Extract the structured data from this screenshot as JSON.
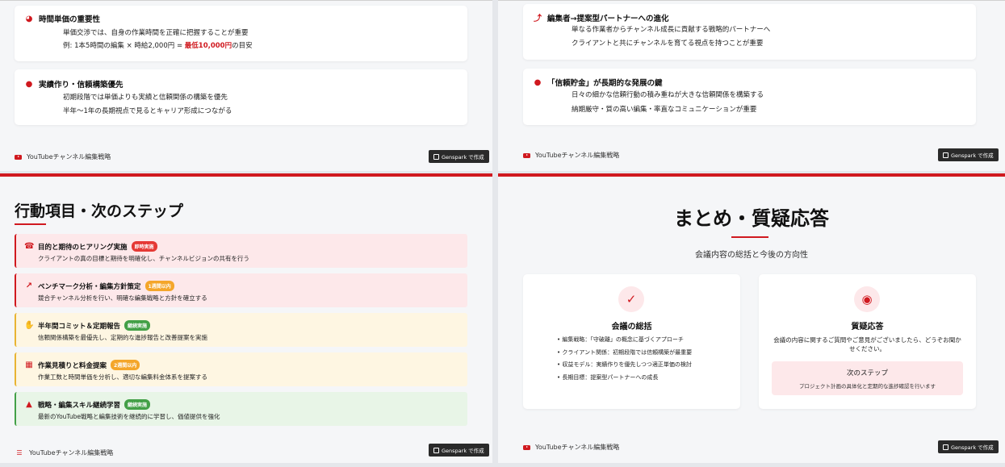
{
  "slide_tl": {
    "cards": [
      {
        "icon": "clock-icon",
        "title": "時間単価の重要性",
        "line1": "単価交渉では、自身の作業時間を正確に把握することが重要",
        "line2_prefix": "例: 1本5時間の編集 × 時給2,000円 = ",
        "line2_highlight": "最低10,000円",
        "line2_suffix": "の目安"
      },
      {
        "icon": "piggy-bank-icon",
        "title": "実績作り・信頼構築優先",
        "line1": "初期段階では単価よりも実績と信頼関係の構築を優先",
        "line2": "半年〜1年の長期視点で見るとキャリア形成につながる"
      }
    ],
    "footer": "YouTubeチャンネル編集戦略",
    "badge": "Genspark で作成"
  },
  "slide_tr": {
    "cards": [
      {
        "icon": "arrow-up-icon",
        "title": "編集者→提案型パートナーへの進化",
        "line1": "単なる作業者からチャンネル成長に貢献する戦略的パートナーへ",
        "line2": "クライアントと共にチャンネルを育てる視点を持つことが重要"
      },
      {
        "icon": "piggy-bank-icon",
        "title": "「信頼貯金」が長期的な発展の鍵",
        "line1": "日々の細かな信頼行動の積み重ねが大きな信頼関係を構築する",
        "line2": "納期厳守・質の高い編集・率直なコミュニケーションが重要"
      }
    ],
    "footer": "YouTubeチャンネル編集戦略",
    "badge": "Genspark で作成"
  },
  "slide_bl": {
    "title": "行動項目・次のステップ",
    "actions": [
      {
        "icon": "headset-icon",
        "title": "目的と期待のヒアリング実施",
        "tag": "即時実施",
        "tag_color": "#e53935",
        "desc": "クライアントの真の目標と期待を明確化し、チャンネルビジョンの共有を行う",
        "tone": "red"
      },
      {
        "icon": "chart-line-icon",
        "title": "ベンチマーク分析・編集方針策定",
        "tag": "1週間以内",
        "tag_color": "#f4a62a",
        "desc": "競合チャンネル分析を行い、明確な編集戦略と方針を確立する",
        "tone": "red"
      },
      {
        "icon": "handshake-icon",
        "title": "半年間コミット＆定期報告",
        "tag": "継続実施",
        "tag_color": "#43a047",
        "desc": "信頼関係構築を最優先し、定期的な進捗報告と改善提案を実施",
        "tone": "yellow"
      },
      {
        "icon": "calculator-icon",
        "title": "作業見積りと料金提案",
        "tag": "2週間以内",
        "tag_color": "#f4a62a",
        "desc": "作業工数と時間単価を分析し、適切な編集料金体系を提案する",
        "tone": "yellow"
      },
      {
        "icon": "graduation-cap-icon",
        "title": "戦略・編集スキル継続学習",
        "tag": "継続実施",
        "tag_color": "#43a047",
        "desc": "最新のYouTube戦略と編集技術を継続的に学習し、価値提供を強化",
        "tone": "green"
      }
    ],
    "footer": "YouTubeチャンネル編集戦略",
    "badge": "Genspark で作成"
  },
  "slide_br": {
    "title": "まとめ・質疑応答",
    "subtitle": "会議内容の総括と今後の方向性",
    "summary": {
      "icon": "clipboard-check-icon",
      "title": "会議の総括",
      "items": [
        "• 編集戦略：「守破離」の概念に基づくアプローチ",
        "• クライアント関係：初期段階では信頼構築が最重要",
        "• 収益モデル：実績作りを優先しつつ適正単価の検討",
        "• 長期目標：提案型パートナーへの成長"
      ]
    },
    "qa": {
      "icon": "chat-bubbles-icon",
      "title": "質疑応答",
      "text": "会議の内容に関するご質問やご意見がございましたら、どうぞお聞かせください。",
      "next_title": "次のステップ",
      "next_text": "プロジェクト計画の具体化と定期的な進捗確認を行います"
    },
    "footer": "YouTubeチャンネル編集戦略",
    "badge": "Genspark で作成"
  },
  "colors": {
    "accent": "#d0191f",
    "green": "#43a047",
    "orange": "#f4a62a"
  }
}
